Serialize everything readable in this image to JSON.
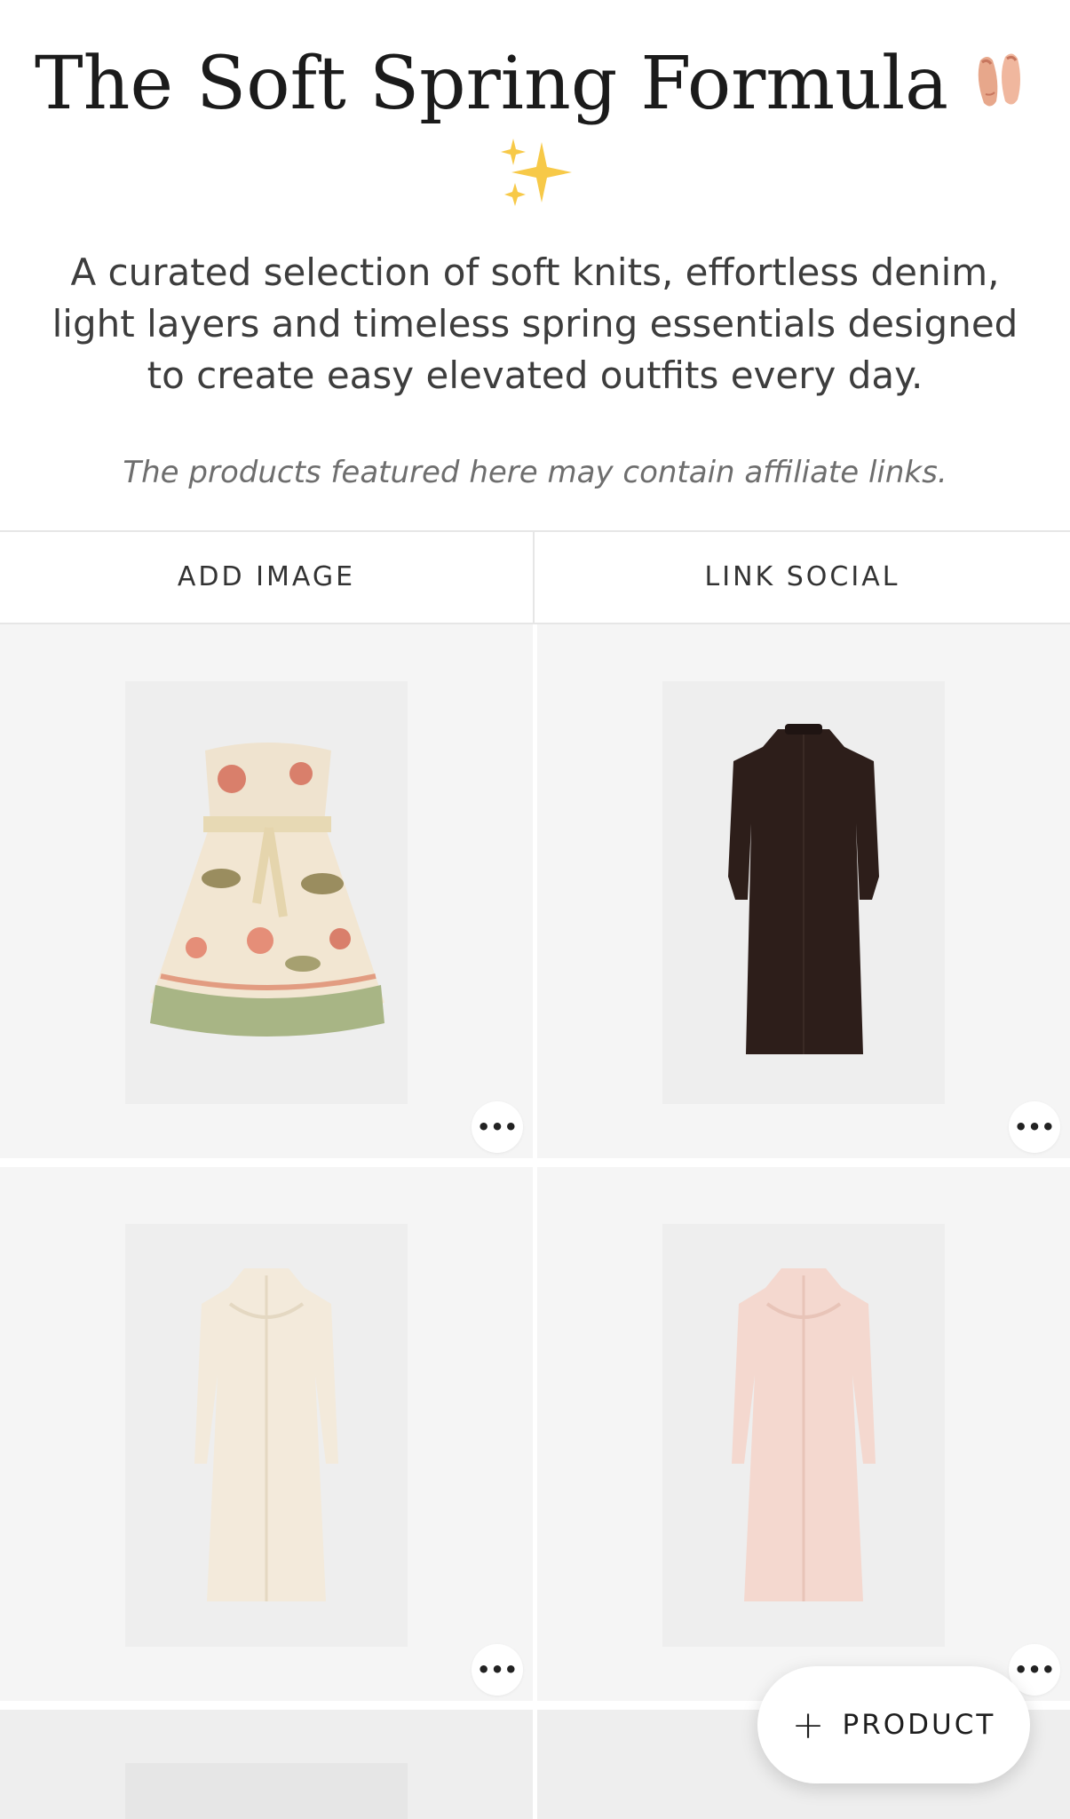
{
  "page": {
    "title": "The Soft Spring Formula",
    "title_emoji_icons": [
      "ballet-shoes-icon",
      "sparkles-icon"
    ],
    "description": "A curated selection of soft knits, effortless denim, light layers and timeless spring essentials designed to create easy elevated outfits every day.",
    "affiliate_note": "The products featured here may contain affiliate links."
  },
  "actions": {
    "add_image": "ADD IMAGE",
    "link_social": "LINK SOCIAL"
  },
  "products": [
    {
      "item": "strapless floral dress",
      "colors": [
        "#f2e6d2",
        "#d97f6b",
        "#a8b585"
      ]
    },
    {
      "item": "dark brown long-sleeve midi dress",
      "colors": [
        "#2d1e1a"
      ]
    },
    {
      "item": "cream embroidered long-sleeve dress",
      "colors": [
        "#f3eadb"
      ]
    },
    {
      "item": "pale pink embroidered long-sleeve dress",
      "colors": [
        "#f4d8cf"
      ]
    }
  ],
  "more_button_icon": "ellipsis-icon",
  "fab": {
    "icon": "plus-icon",
    "label": "PRODUCT"
  },
  "colors": {
    "card_background": "#f5f5f5",
    "photo_background": "#eeeeee",
    "divider": "#e6e6e6",
    "text": "#1e1e1e"
  }
}
